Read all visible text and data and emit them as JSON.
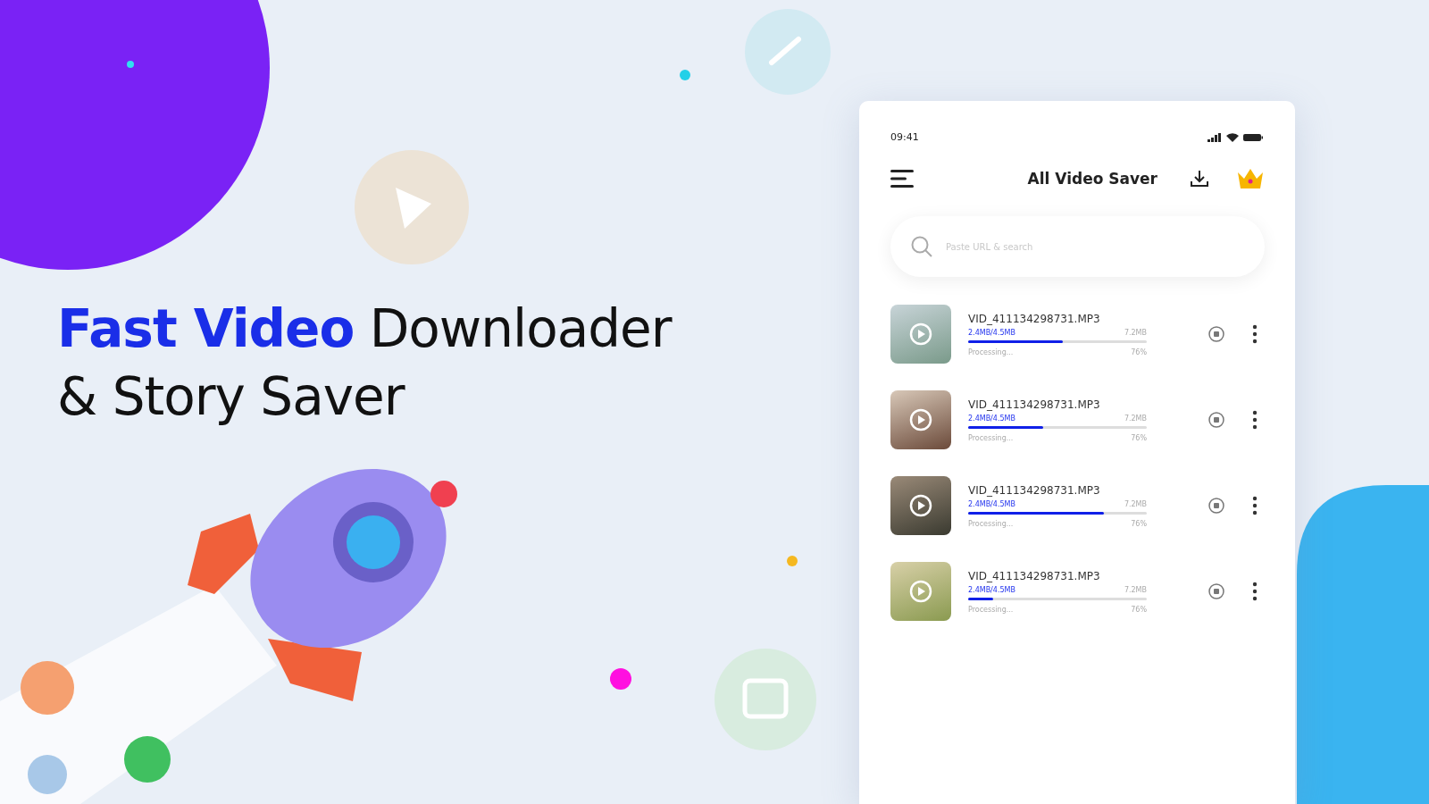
{
  "headline": {
    "lines": [
      "**Fast Video** Downloader",
      "& Story Saver"
    ]
  },
  "phone": {
    "status_bar": {
      "time": "09:41"
    },
    "app_bar": {
      "title": "All Video Saver"
    },
    "search": {
      "placeholder": "Paste URL & search"
    },
    "downloads": [
      {
        "file_name": "VID_411134298731.MP3",
        "progress_text": "2.4MB/4.5MB",
        "total_size": "7.2MB",
        "status": "Processing...",
        "percent": "76%",
        "level": 0.53
      },
      {
        "file_name": "VID_411134298731.MP3",
        "progress_text": "2.4MB/4.5MB",
        "total_size": "7.2MB",
        "status": "Processing...",
        "percent": "76%",
        "level": 0.42
      },
      {
        "file_name": "VID_411134298731.MP3",
        "progress_text": "2.4MB/4.5MB",
        "total_size": "7.2MB",
        "status": "Processing...",
        "percent": "76%",
        "level": 0.76
      },
      {
        "file_name": "VID_411134298731.MP3",
        "progress_text": "2.4MB/4.5MB",
        "total_size": "7.2MB",
        "status": "Processing...",
        "percent": "76%",
        "level": 0.14
      }
    ]
  }
}
